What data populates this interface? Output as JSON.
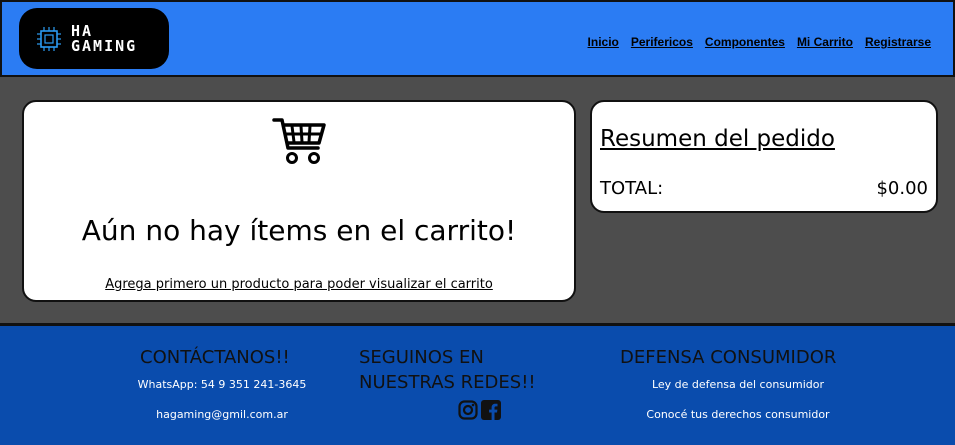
{
  "header": {
    "logo_line1": "HA",
    "logo_line2": "GAMING",
    "nav": [
      "Inicio",
      "Perifericos",
      "Componentes",
      "Mi Carrito",
      "Registrarse"
    ]
  },
  "cart": {
    "icon": "shopping-cart-icon",
    "empty_title": "Aún no hay ítems en el carrito!",
    "empty_link": "Agrega primero un producto para poder visualizar el carrito"
  },
  "summary": {
    "title": "Resumen del pedido",
    "total_label": "TOTAL:",
    "total_value": "$0.00"
  },
  "footer": {
    "contact_title": "CONTÁCTANOS!!",
    "whatsapp": "WhatsApp: 54 9 351 241-3645",
    "email": "hagaming@gmil.com.ar",
    "social_title_1": "SEGUINOS EN",
    "social_title_2": "NUESTRAS REDES!!",
    "social_icons": [
      "instagram-icon",
      "facebook-icon"
    ],
    "defense_title": "DEFENSA CONSUMIDOR",
    "defense_link1": "Ley de defensa del consumidor",
    "defense_link2": "Conocé tus derechos consumidor"
  },
  "colors": {
    "header_bg": "#2b7cf3",
    "page_bg": "#4d4d4d",
    "footer_bg": "#0a4cad"
  }
}
